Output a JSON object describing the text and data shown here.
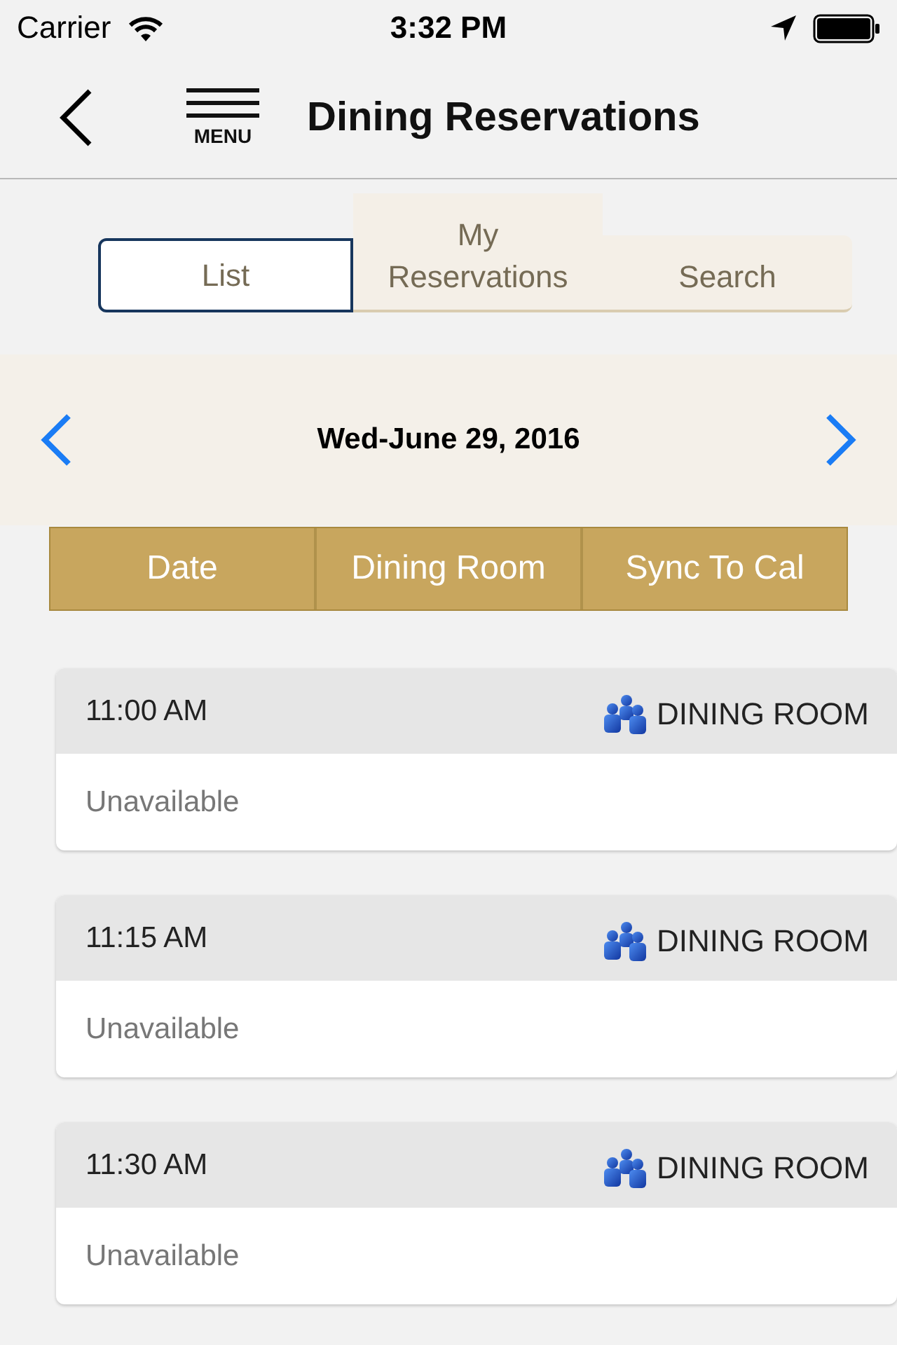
{
  "status_bar": {
    "carrier": "Carrier",
    "time": "3:32 PM"
  },
  "nav_bar": {
    "menu_label": "MENU",
    "title": "Dining Reservations"
  },
  "tabs": [
    {
      "label": "List",
      "selected": true
    },
    {
      "label": "My Reservations",
      "selected": false
    },
    {
      "label": "Search",
      "selected": false
    }
  ],
  "date_bar": {
    "date": "Wed-June 29, 2016"
  },
  "columns": [
    "Date",
    "Dining Room",
    "Sync To Cal"
  ],
  "slots": [
    {
      "time": "11:00 AM",
      "room": "DINING ROOM",
      "status": "Unavailable"
    },
    {
      "time": "11:15 AM",
      "room": "DINING ROOM",
      "status": "Unavailable"
    },
    {
      "time": "11:30 AM",
      "room": "DINING ROOM",
      "status": "Unavailable"
    }
  ]
}
